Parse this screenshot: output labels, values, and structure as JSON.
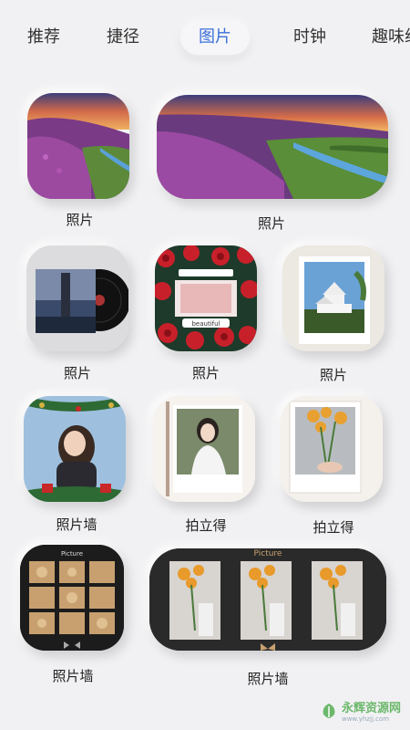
{
  "tabs": [
    {
      "label": "推荐",
      "active": false
    },
    {
      "label": "捷径",
      "active": false
    },
    {
      "label": "图片",
      "active": true
    },
    {
      "label": "时钟",
      "active": false
    },
    {
      "label": "趣味组",
      "active": false
    }
  ],
  "widgets": {
    "row1": [
      "照片",
      "照片"
    ],
    "row2": [
      "照片",
      "照片",
      "照片"
    ],
    "row3": [
      "照片墙",
      "拍立得",
      "拍立得"
    ],
    "row4": [
      "照片墙",
      "照片墙"
    ]
  },
  "thumb_text": {
    "beautiful": "beautiful",
    "picture_a": "Picture",
    "picture_b": "Picture"
  },
  "watermark": {
    "text": "永辉资源网",
    "sub": "www.yhzjj.com"
  },
  "colors": {
    "active_tab": "#3b6fd8",
    "background": "#f1f1f3"
  }
}
